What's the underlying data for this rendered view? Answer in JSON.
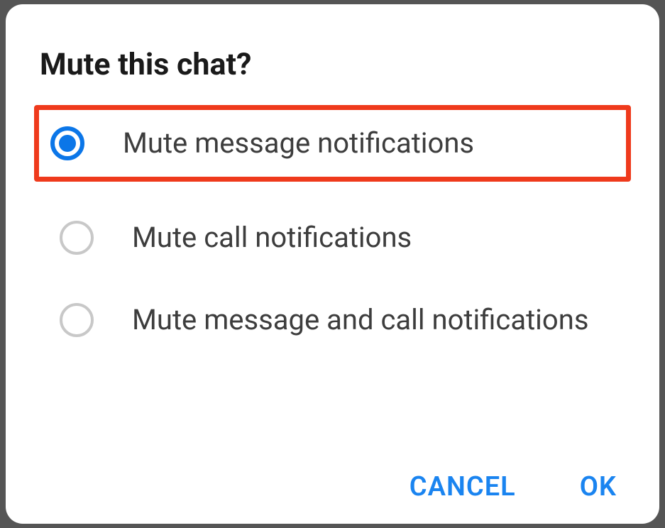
{
  "dialog": {
    "title": "Mute this chat?",
    "options": [
      {
        "label": "Mute message notifications",
        "selected": true,
        "highlighted": true
      },
      {
        "label": "Mute call notifications",
        "selected": false,
        "highlighted": false
      },
      {
        "label": "Mute message and call notifications",
        "selected": false,
        "highlighted": false
      }
    ],
    "actions": {
      "cancel": "CANCEL",
      "ok": "OK"
    }
  },
  "colors": {
    "accent": "#1a84f0",
    "highlight_border": "#ef3a1c",
    "radio_selected": "#0b76e8"
  }
}
